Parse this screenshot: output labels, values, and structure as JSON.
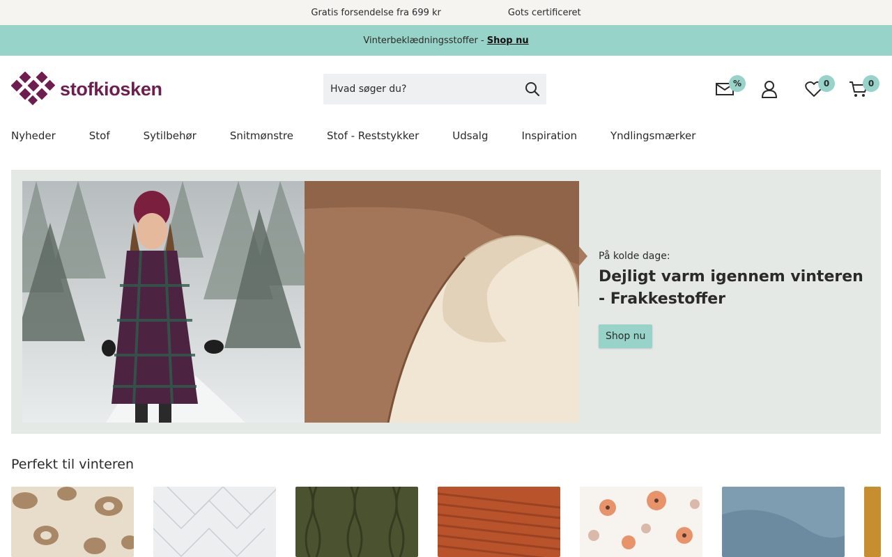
{
  "topbar": {
    "items": [
      "Gratis forsendelse fra 699 kr",
      "Gots certificeret"
    ]
  },
  "promo": {
    "text": "Vinterbeklædningsstoffer -",
    "link": "Shop nu"
  },
  "logo": {
    "text": "stofkiosken",
    "brand_color": "#6e1e4e"
  },
  "search": {
    "placeholder": "Hvad søger du?"
  },
  "header_icons": {
    "newsletter_badge": "%",
    "wishlist_count": "0",
    "cart_count": "0"
  },
  "nav": {
    "items": [
      "Nyheder",
      "Stof",
      "Sytilbehør",
      "Snitmønstre",
      "Stof - Reststykker",
      "Udsalg",
      "Inspiration",
      "Yndlingsmærker"
    ]
  },
  "hero": {
    "kicker": "På kolde dage:",
    "title": "Dejligt varm igennem vinteren - Frakkestoffer",
    "button": "Shop nu"
  },
  "section": {
    "title": "Perfekt til vinteren"
  },
  "colors": {
    "accent": "#97d3c8",
    "topbar_bg": "#f5f4f1",
    "hero_bg": "#e5e9e6"
  }
}
